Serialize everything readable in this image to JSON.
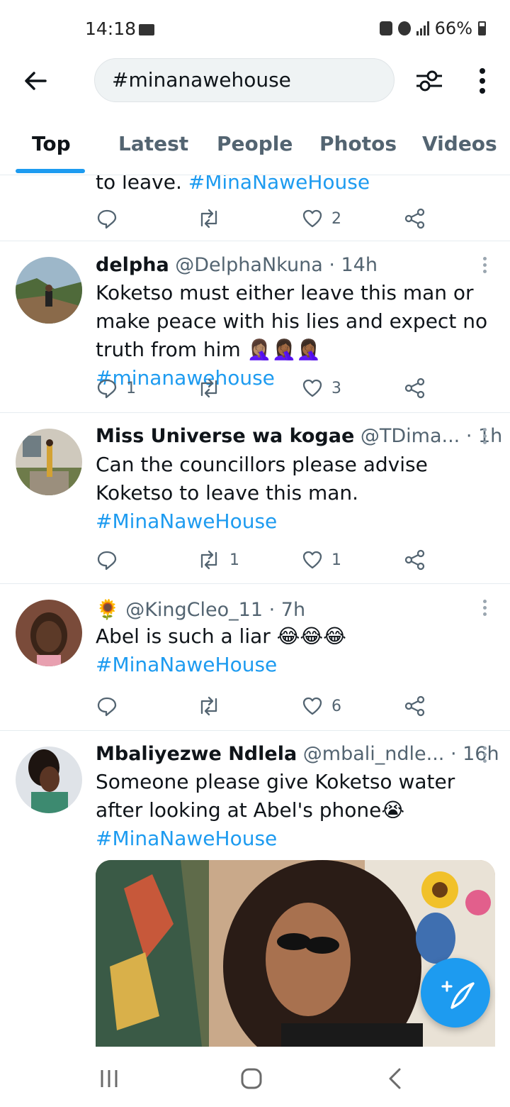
{
  "status_bar": {
    "time": "14:18",
    "battery": "66%"
  },
  "search": {
    "value": "#minanawehouse"
  },
  "tabs": [
    "Top",
    "Latest",
    "People",
    "Photos",
    "Videos"
  ],
  "tweets": [
    {
      "partial_text": "to leave. ",
      "partial_tag": "#MinaNaweHouse",
      "likes": "2"
    },
    {
      "name": "delpha",
      "handle": "@DelphaNkuna · 14h",
      "text": "Koketso must either leave this man or make peace with his lies and expect no truth from him 🤦🏽‍♀️🤦🏾‍♀️🤦🏾‍♀️ ",
      "tag": "#minanawehouse",
      "replies": "1",
      "likes": "3"
    },
    {
      "name": "Miss Universe wa kogae",
      "handle": "@TDima... · 1h",
      "text": "Can the councillors please advise Koketso to leave this man.",
      "tag": "#MinaNaweHouse",
      "retweets": "1",
      "likes": "1"
    },
    {
      "name": "🌻",
      "handle": "@KingCleo_11 · 7h",
      "text": "Abel is such a liar 😂😂😂",
      "tag": "#MinaNaweHouse",
      "likes": "6"
    },
    {
      "name": "Mbaliyezwe Ndlela",
      "handle": "@mbali_ndle... · 16h",
      "text": "Someone please give Koketso water after looking at Abel's phone😭",
      "tag": "#MinaNaweHouse"
    }
  ],
  "colors": {
    "accent": "#1d9bf0",
    "text": "#0f1419",
    "muted": "#536471",
    "divider": "#e6ecf0"
  },
  "icons": [
    "back-arrow-icon",
    "filter-icon",
    "more-vertical-icon",
    "reply-icon",
    "retweet-icon",
    "like-icon",
    "share-icon",
    "compose-icon",
    "recents-icon",
    "home-icon",
    "nav-back-icon"
  ]
}
